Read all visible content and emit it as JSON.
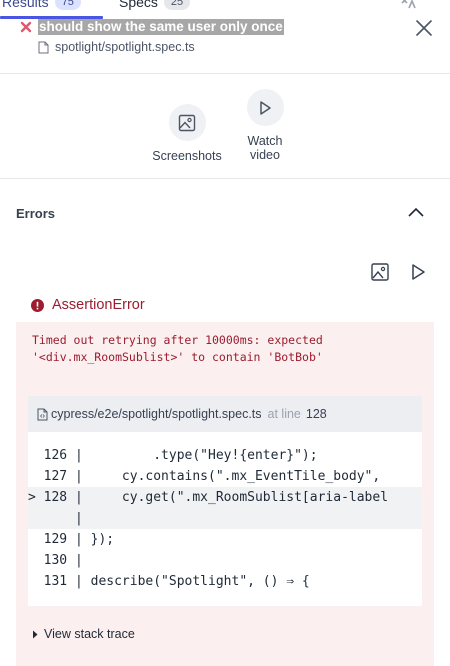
{
  "tabs": [
    {
      "label": "Results",
      "count": "75"
    },
    {
      "label": "Specs",
      "count": "25"
    }
  ],
  "test": {
    "title": "should show the same user only once",
    "spec_file": "spotlight/spotlight.spec.ts"
  },
  "actions": {
    "screenshots_label": "Screenshots",
    "watch_label_1": "Watch",
    "watch_label_2": "video"
  },
  "errors": {
    "section_title": "Errors",
    "error_name": "AssertionError",
    "message": "Timed out retrying after 10000ms: expected\n'<div.mx_RoomSublist>' to contain 'BotBob'",
    "file_path": "cypress/e2e/spotlight/spotlight.spec.ts",
    "at_line_prefix": "at line",
    "line_number": "128",
    "code_lines": [
      "  126 |         .type(\"Hey!{enter}\");",
      "  127 |     cy.contains(\".mx_EventTile_body\", ",
      "> 128 |     cy.get(\".mx_RoomSublist[aria-label",
      "      |",
      "  129 | });",
      "  130 |",
      "  131 | describe(\"Spotlight\", () ⇒ {"
    ],
    "stack_trace_label": "View stack trace"
  },
  "colors": {
    "accent": "#4956e3",
    "error_text": "#9b1d2f",
    "error_panel": "#fcefef",
    "fail_icon": "#e45770"
  },
  "icons": [
    "collapse-panel-icon",
    "fail-x-icon",
    "close-icon",
    "file-icon",
    "image-icon",
    "play-icon",
    "chevron-up-icon",
    "error-circle-icon",
    "caret-right-icon"
  ]
}
